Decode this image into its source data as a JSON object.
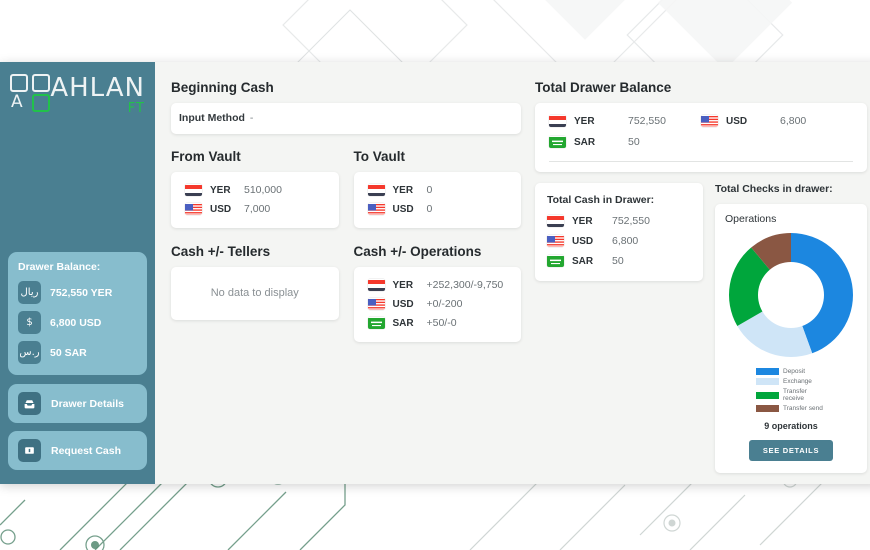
{
  "brand": {
    "name": "AHLAN",
    "sub": "FT",
    "letter": "A"
  },
  "sidebar": {
    "drawer_balance": {
      "title": "Drawer Balance:",
      "rows": [
        {
          "icon": "yer-riyal-icon",
          "glyph": "ريال",
          "label": "752,550 YER"
        },
        {
          "icon": "usd-dollar-icon",
          "glyph": "$",
          "label": "6,800 USD"
        },
        {
          "icon": "sar-riyal-icon",
          "glyph": "ر.س",
          "label": "50 SAR"
        }
      ]
    },
    "actions": [
      {
        "icon": "inbox-icon",
        "label": "Drawer Details"
      },
      {
        "icon": "banknote-icon",
        "label": "Request Cash"
      }
    ]
  },
  "main": {
    "beginning_cash": {
      "title": "Beginning Cash",
      "field_label": "Input Method",
      "field_value": "-"
    },
    "from_vault": {
      "title": "From Vault",
      "rows": [
        {
          "flag": "yemen-flag",
          "code": "YER",
          "value": "510,000"
        },
        {
          "flag": "usa-flag",
          "code": "USD",
          "value": "7,000"
        }
      ]
    },
    "to_vault": {
      "title": "To Vault",
      "rows": [
        {
          "flag": "yemen-flag",
          "code": "YER",
          "value": "0"
        },
        {
          "flag": "usa-flag",
          "code": "USD",
          "value": "0"
        }
      ]
    },
    "cash_tellers": {
      "title": "Cash +/- Tellers",
      "empty": "No data to display"
    },
    "cash_operations": {
      "title": "Cash +/- Operations",
      "rows": [
        {
          "flag": "yemen-flag",
          "code": "YER",
          "value": "+252,300/-9,750"
        },
        {
          "flag": "usa-flag",
          "code": "USD",
          "value": "+0/-200"
        },
        {
          "flag": "saudi-flag",
          "code": "SAR",
          "value": "+50/-0"
        }
      ]
    }
  },
  "right": {
    "total_drawer_balance": {
      "title": "Total Drawer Balance",
      "cells": [
        {
          "flag": "yemen-flag",
          "code": "YER",
          "value": "752,550"
        },
        {
          "flag": "usa-flag",
          "code": "USD",
          "value": "6,800"
        },
        {
          "flag": "saudi-flag",
          "code": "SAR",
          "value": "50"
        }
      ]
    },
    "total_cash_in_drawer": {
      "title": "Total Cash in Drawer:",
      "rows": [
        {
          "flag": "yemen-flag",
          "code": "YER",
          "value": "752,550"
        },
        {
          "flag": "usa-flag",
          "code": "USD",
          "value": "6,800"
        },
        {
          "flag": "saudi-flag",
          "code": "SAR",
          "value": "50"
        }
      ]
    },
    "total_checks_in_drawer": {
      "title": "Total Checks in drawer:"
    },
    "operations_card": {
      "title": "Operations",
      "count_label": "9 operations",
      "see_details": "SEE DETAILS"
    }
  },
  "chart_data": {
    "type": "pie",
    "title": "Operations",
    "donut": true,
    "total": 9,
    "total_label": "9 operations",
    "legend_position": "bottom",
    "categories": [
      "Deposit",
      "Exchange",
      "Transfer receive",
      "Transfer send"
    ],
    "values": [
      4,
      2,
      2,
      1
    ],
    "colors": [
      "#1c87e0",
      "#cfe5f7",
      "#00a63c",
      "#8a5743"
    ]
  },
  "colors": {
    "sidebar": "#4a7f91",
    "sidebar_card": "#87bdcd",
    "accent_green": "#21c24a",
    "window_bg": "#f4f5f3"
  }
}
